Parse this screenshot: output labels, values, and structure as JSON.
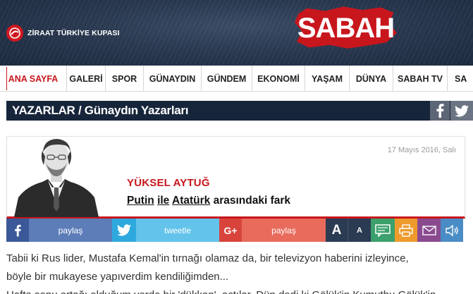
{
  "header": {
    "cup_text": "ZİRAAT TÜRKİYE KUPASI",
    "brand": "SABAH",
    "brand_color": "#c8161d"
  },
  "nav": {
    "items": [
      {
        "label": "ANA SAYFA",
        "active": true
      },
      {
        "label": "GALERİ"
      },
      {
        "label": "SPOR"
      },
      {
        "label": "GÜNAYDIN"
      },
      {
        "label": "GÜNDEM"
      },
      {
        "label": "EKONOMİ"
      },
      {
        "label": "YAŞAM"
      },
      {
        "label": "DÜNYA"
      },
      {
        "label": "SABAH TV"
      },
      {
        "label": "SA"
      }
    ]
  },
  "section": {
    "title": "YAZARLAR / Günaydın Yazarları",
    "icons": [
      "facebook-icon",
      "twitter-icon"
    ]
  },
  "article": {
    "date": "17 Mayıs 2016, Salı",
    "author": "YÜKSEL AYTUĞ",
    "headline_part1": "Putin",
    "headline_part2": "ile",
    "headline_part3": "Atatürk",
    "headline_rest": "arasındaki fark"
  },
  "share": {
    "facebook_label": "paylaş",
    "twitter_label": "tweetle",
    "gplus_label": "paylaş",
    "font_big": "A",
    "font_small": "A",
    "tool_icons": [
      "comment-icon",
      "print-icon",
      "mail-icon",
      "sound-icon"
    ]
  },
  "body": {
    "line1": "Tabii ki Rus lider, Mustafa Kemal'in tırnağı olamaz da, bir televizyon haberini izleyince,",
    "line2": "böyle bir mukayese yapıverdim kendiliğimden...",
    "line3": "Hafta sonu ortağı olduğum yerde bir 'dükkan', açtılar. Dün dedi ki Gölük'in Kumuthu Gölük'in"
  }
}
